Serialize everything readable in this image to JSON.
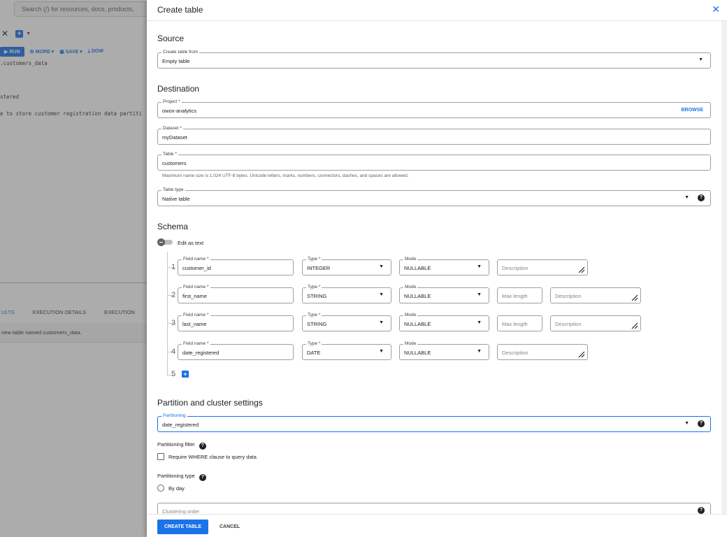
{
  "background": {
    "search_placeholder": "Search (/) for resources, docs, products,",
    "toolbar": {
      "run": "RUN",
      "more": "MORE",
      "save": "SAVE",
      "download": "DOW"
    },
    "code_lines": [
      ".customers_data",
      "",
      "",
      "",
      "stered",
      "",
      "e to store customer registration data partiti"
    ],
    "results_tabs": [
      "ULTS",
      "EXECUTION DETAILS",
      "EXECUTION"
    ],
    "results_message": "new table named customers_data."
  },
  "panel": {
    "title": "Create table",
    "source": {
      "heading": "Source",
      "create_from_label": "Create table from",
      "create_from_value": "Empty table"
    },
    "destination": {
      "heading": "Destination",
      "project_label": "Project *",
      "project_value": "owox-analytics",
      "browse_label": "BROWSE",
      "dataset_label": "Dataset *",
      "dataset_value": "myDataset",
      "table_label": "Table *",
      "table_value": "customers",
      "table_hint": "Maximum name size is 1,024 UTF-8 bytes. Unicode letters, marks, numbers, connectors, dashes, and spaces are allowed.",
      "table_type_label": "Table type",
      "table_type_value": "Native table"
    },
    "schema": {
      "heading": "Schema",
      "edit_as_text": "Edit as text",
      "field_name_label": "Field name *",
      "type_label": "Type *",
      "mode_label": "Mode",
      "max_length_placeholder": "Max length",
      "description_placeholder": "Description",
      "rows": [
        {
          "num": "1",
          "name": "customer_id",
          "type": "INTEGER",
          "mode": "NULLABLE"
        },
        {
          "num": "2",
          "name": "first_name",
          "type": "STRING",
          "mode": "NULLABLE"
        },
        {
          "num": "3",
          "name": "last_name",
          "type": "STRING",
          "mode": "NULLABLE"
        },
        {
          "num": "4",
          "name": "date_registered",
          "type": "DATE",
          "mode": "NULLABLE"
        }
      ],
      "next_row_num": "5"
    },
    "partition": {
      "heading": "Partition and cluster settings",
      "partitioning_label": "Partitioning",
      "partitioning_value": "date_registered",
      "filter_label": "Partitioning filter",
      "require_where": "Require WHERE clause to query data",
      "type_label": "Partitioning type",
      "by_day": "By day",
      "clustering_placeholder": "Clustering order"
    },
    "footer": {
      "create": "CREATE TABLE",
      "cancel": "CANCEL"
    }
  }
}
